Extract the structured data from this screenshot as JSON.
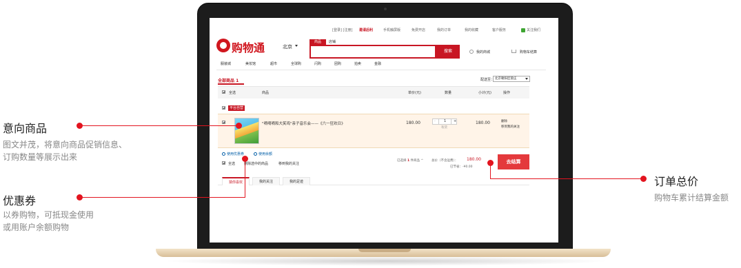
{
  "topbar": {
    "login_register": "[登录] [注册]",
    "invite": "邀请后利",
    "mobile": "手机触屏版",
    "open_store": "免费开店",
    "my_orders": "我的订单",
    "my_fav": "我的收藏",
    "service": "客户服务",
    "follow": "关注我们"
  },
  "header": {
    "logo_text": "购物通",
    "city": "北京",
    "search_tab_goods": "商品",
    "search_tab_store": "店铺",
    "search_button": "搜索",
    "my_mall": "我的商城",
    "cart_checkout": "购物车结算"
  },
  "nav": [
    "服装城",
    "美妆馆",
    "超市",
    "全球购",
    "闪购",
    "团购",
    "拍卖",
    "金融"
  ],
  "cart": {
    "all_goods": "全部商品 1",
    "ship_to_label": "配送至：",
    "ship_to_value": "北京朝阳区管庄",
    "columns": {
      "select_all": "全选",
      "product": "商品",
      "unit_price": "单价(元)",
      "quantity": "数量",
      "subtotal": "小计(元)",
      "operation": "操作"
    },
    "shop_badge": "平台自营",
    "item": {
      "title": "\"嘀嘀嘀和大笑鸡\"亲子音乐会——《六一狂欢日》",
      "unit_price": "180.00",
      "qty": "1",
      "minus": "-",
      "plus": "+",
      "stock": "有货",
      "subtotal": "180.00",
      "delete": "删除",
      "move_to_fav": "移到我的关注"
    },
    "use_coupon": "使用优惠券",
    "use_balance": "使用余额",
    "footer_select_all": "全选",
    "delete_selected": "删除选中的商品",
    "move_fav": "移到我的关注",
    "selected_count_prefix": "已选择",
    "selected_count": "1",
    "selected_count_suffix": "件商品",
    "total_label": "总价（不含运费）：",
    "total_value": "180.00",
    "saved": "已节省：-¥0.00",
    "checkout": "去结算"
  },
  "recommend_tabs": [
    "猜你喜欢",
    "我的关注",
    "我的足迹"
  ],
  "callouts": {
    "intent": {
      "title": "意向商品",
      "desc1": "图文并茂，将意向商品促销信息、",
      "desc2": "订购数量等展示出来"
    },
    "coupon": {
      "title": "优惠券",
      "desc1": "以券购物，可抵现金使用",
      "desc2": "或用账户余额购物"
    },
    "total": {
      "title": "订单总价",
      "desc1": "购物车累计结算金额"
    }
  },
  "colors": {
    "brand_red": "#c81623",
    "callout_red": "#e3141f",
    "checkout_red": "#e4393c",
    "link_blue": "#005ea7"
  }
}
